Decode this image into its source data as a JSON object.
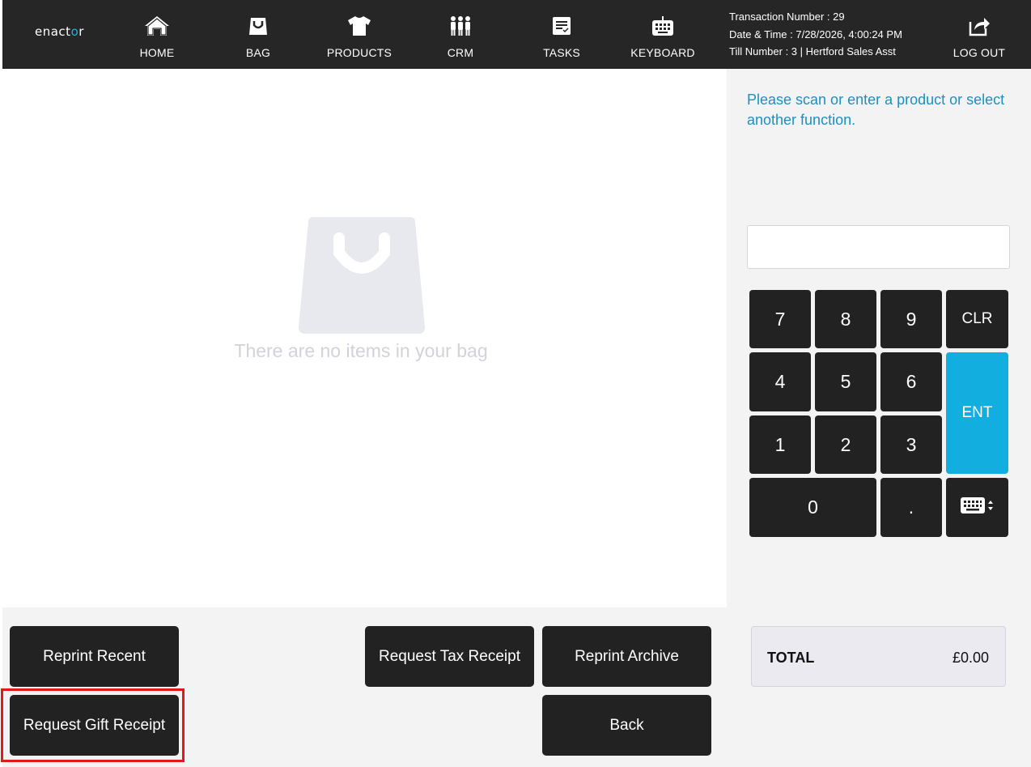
{
  "app": {
    "logo_prefix": "enact",
    "logo_accent": "o",
    "logo_suffix": "r"
  },
  "nav": {
    "items": [
      {
        "label": "HOME",
        "icon": "home-icon"
      },
      {
        "label": "BAG",
        "icon": "bag-icon"
      },
      {
        "label": "PRODUCTS",
        "icon": "tshirt-icon"
      },
      {
        "label": "CRM",
        "icon": "people-icon"
      },
      {
        "label": "TASKS",
        "icon": "tasks-icon"
      },
      {
        "label": "KEYBOARD",
        "icon": "keyboard-icon"
      }
    ],
    "logout_label": "LOG OUT"
  },
  "transaction": {
    "number": "Transaction Number : 29",
    "datetime": "Date & Time : 7/28/2026, 4:00:24 PM",
    "till": "Till Number : 3  |  Hertford Sales Asst"
  },
  "bag": {
    "empty_message": "There are no items in your bag"
  },
  "panel": {
    "prompt": "Please scan or enter a product or select another function.",
    "entry_value": "",
    "keys": {
      "k7": "7",
      "k8": "8",
      "k9": "9",
      "clr": "CLR",
      "k4": "4",
      "k5": "5",
      "k6": "6",
      "ent": "ENT",
      "k1": "1",
      "k2": "2",
      "k3": "3",
      "k0": "0",
      "dot": ".",
      "keyboard_toggle": "keyboard-toggle-icon"
    },
    "total_label": "TOTAL",
    "total_value": "£0.00"
  },
  "actions": {
    "reprint_recent": "Reprint Recent",
    "request_tax_receipt": "Request Tax Receipt",
    "reprint_archive": "Reprint Archive",
    "request_gift_receipt": "Request Gift Receipt",
    "back": "Back"
  },
  "colors": {
    "topbar": "#262626",
    "accent": "#12aee0",
    "prompt": "#1d8fc0",
    "highlight": "#e0191f"
  }
}
